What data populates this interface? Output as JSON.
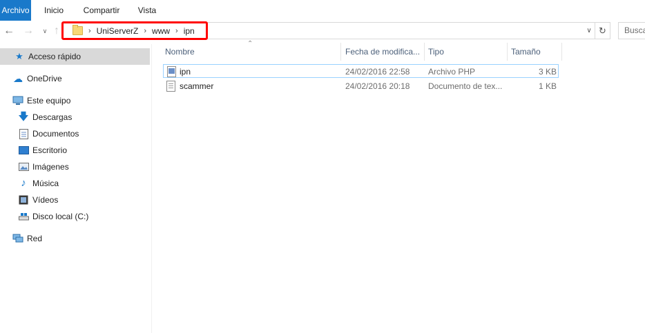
{
  "ribbon": {
    "tabs": [
      {
        "label": "Archivo",
        "active": true
      },
      {
        "label": "Inicio"
      },
      {
        "label": "Compartir"
      },
      {
        "label": "Vista"
      }
    ]
  },
  "navigation": {
    "back_icon": "arrow-left-icon",
    "forward_icon": "arrow-right-icon",
    "recent_icon": "chevron-down-icon",
    "up_icon": "arrow-up-icon"
  },
  "address": {
    "breadcrumb": [
      "UniServerZ",
      "www",
      "ipn"
    ],
    "highlight_color": "#ff0000"
  },
  "search": {
    "placeholder": "Buscar en ipn"
  },
  "nav_pane": {
    "items": [
      {
        "label": "Acceso rápido",
        "icon": "star-icon",
        "selected": true
      },
      {
        "label": "OneDrive",
        "icon": "cloud-icon"
      },
      {
        "label": "Este equipo",
        "icon": "computer-icon"
      },
      {
        "label": "Descargas",
        "icon": "download-icon"
      },
      {
        "label": "Documentos",
        "icon": "document-icon"
      },
      {
        "label": "Escritorio",
        "icon": "desktop-icon"
      },
      {
        "label": "Imágenes",
        "icon": "pictures-icon"
      },
      {
        "label": "Música",
        "icon": "music-icon"
      },
      {
        "label": "Vídeos",
        "icon": "video-icon"
      },
      {
        "label": "Disco local (C:)",
        "icon": "drive-icon"
      },
      {
        "label": "Red",
        "icon": "network-icon"
      }
    ]
  },
  "file_list": {
    "columns": [
      "Nombre",
      "Fecha de modifica...",
      "Tipo",
      "Tamaño"
    ],
    "rows": [
      {
        "name": "ipn",
        "date": "24/02/2016 22:58",
        "type": "Archivo PHP",
        "size": "3 KB",
        "icon": "php-file-icon"
      },
      {
        "name": "scammer",
        "date": "24/02/2016 20:18",
        "type": "Documento de tex...",
        "size": "1 KB",
        "icon": "text-file-icon"
      }
    ]
  },
  "colors": {
    "accent": "#1979ca",
    "selection_outline": "#99d1ff",
    "nav_selected": "#d9d9d9"
  }
}
